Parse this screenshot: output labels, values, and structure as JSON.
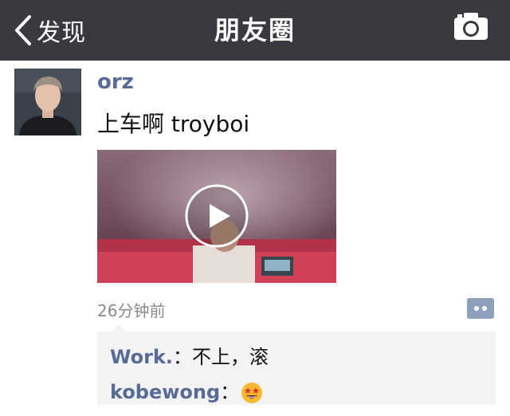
{
  "nav": {
    "back_label": "发现",
    "title": "朋友圈"
  },
  "post": {
    "username": "orz",
    "text": "上车啊 troyboi",
    "time": "26分钟前"
  },
  "comments": [
    {
      "author": "Work.",
      "sep": "：",
      "text": "不上，滚"
    },
    {
      "author": "kobewong",
      "sep": "：",
      "emoji": "star-struck-emoji"
    }
  ],
  "colors": {
    "nav_bg": "#393a3f",
    "link": "#576b95",
    "comment_bg": "#f3f3f5"
  },
  "icons": [
    "chevron-left-icon",
    "camera-icon",
    "play-icon",
    "comment-action-icon"
  ]
}
